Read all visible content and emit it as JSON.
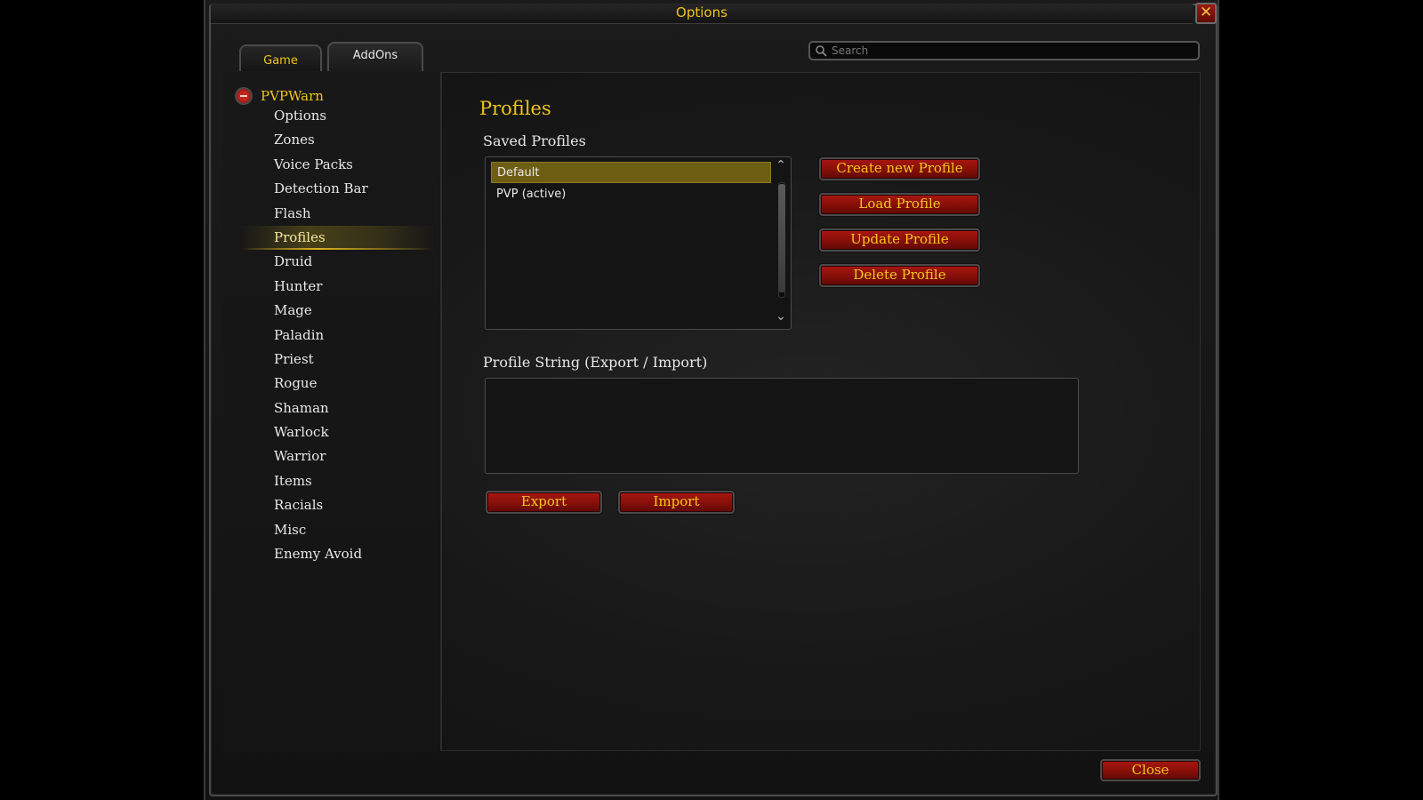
{
  "window": {
    "title": "Options",
    "close_x": "✕"
  },
  "tabs": [
    {
      "label": "Game",
      "active": true
    },
    {
      "label": "AddOns",
      "active": false
    }
  ],
  "search": {
    "placeholder": "Search",
    "value": ""
  },
  "sidebar": {
    "addon_name": "PVPWarn",
    "items": [
      {
        "label": "Options"
      },
      {
        "label": "Zones"
      },
      {
        "label": "Voice Packs"
      },
      {
        "label": "Detection Bar"
      },
      {
        "label": "Flash"
      },
      {
        "label": "Profiles",
        "active": true
      },
      {
        "label": "Druid"
      },
      {
        "label": "Hunter"
      },
      {
        "label": "Mage"
      },
      {
        "label": "Paladin"
      },
      {
        "label": "Priest"
      },
      {
        "label": "Rogue"
      },
      {
        "label": "Shaman"
      },
      {
        "label": "Warlock"
      },
      {
        "label": "Warrior"
      },
      {
        "label": "Items"
      },
      {
        "label": "Racials"
      },
      {
        "label": "Misc"
      },
      {
        "label": "Enemy Avoid"
      }
    ]
  },
  "content": {
    "title": "Profiles",
    "saved_profiles_label": "Saved Profiles",
    "profiles": [
      {
        "name": "Default",
        "selected": true
      },
      {
        "name": "PVP (active)",
        "selected": false
      }
    ],
    "buttons": {
      "create": "Create new Profile",
      "load": "Load Profile",
      "update": "Update Profile",
      "delete": "Delete Profile"
    },
    "profile_string_label": "Profile String (Export / Import)",
    "profile_string_value": "",
    "export_label": "Export",
    "import_label": "Import"
  },
  "footer": {
    "close_label": "Close"
  },
  "colors": {
    "accent_gold": "#f0c419",
    "button_red": "#a8170f",
    "selected_row": "#6e5e14"
  }
}
